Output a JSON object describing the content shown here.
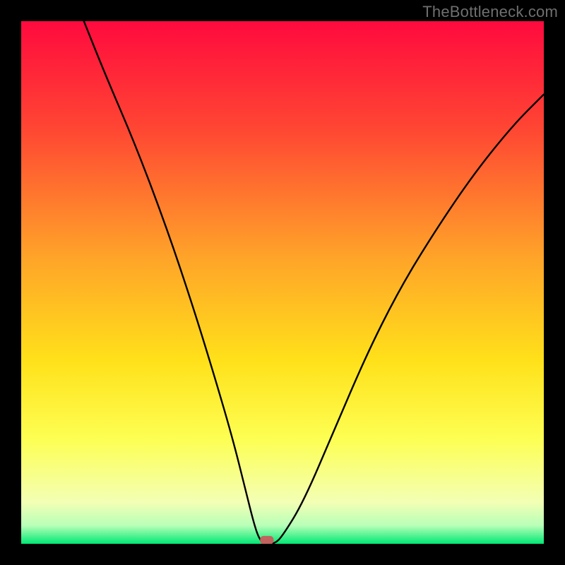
{
  "watermark": {
    "text": "TheBottleneck.com"
  },
  "chart_data": {
    "type": "line",
    "title": "",
    "xlabel": "",
    "ylabel": "",
    "xlim": [
      0,
      100
    ],
    "ylim": [
      0,
      100
    ],
    "gradient_stops": [
      {
        "offset": 0.0,
        "color": "#ff0a3e"
      },
      {
        "offset": 0.2,
        "color": "#ff4433"
      },
      {
        "offset": 0.45,
        "color": "#ffa329"
      },
      {
        "offset": 0.65,
        "color": "#ffe11a"
      },
      {
        "offset": 0.8,
        "color": "#fdff53"
      },
      {
        "offset": 0.92,
        "color": "#f3ffb4"
      },
      {
        "offset": 0.965,
        "color": "#b8ffb8"
      },
      {
        "offset": 1.0,
        "color": "#00e874"
      }
    ],
    "series": [
      {
        "name": "bottleneck-curve",
        "x": [
          12,
          16,
          22,
          28,
          33,
          37,
          40.5,
          43,
          44.5,
          45.5,
          46.5,
          48.5,
          50,
          54,
          60,
          66,
          72,
          78,
          86,
          94,
          100
        ],
        "y": [
          100,
          90,
          76,
          60,
          45,
          32,
          20,
          10,
          4,
          1,
          0,
          0,
          1.5,
          8,
          22,
          36,
          48,
          58,
          70,
          80,
          86
        ]
      }
    ],
    "marker": {
      "x": 47,
      "y": 0.7,
      "width": 2.6,
      "height": 1.6,
      "color": "#c1625e"
    }
  }
}
